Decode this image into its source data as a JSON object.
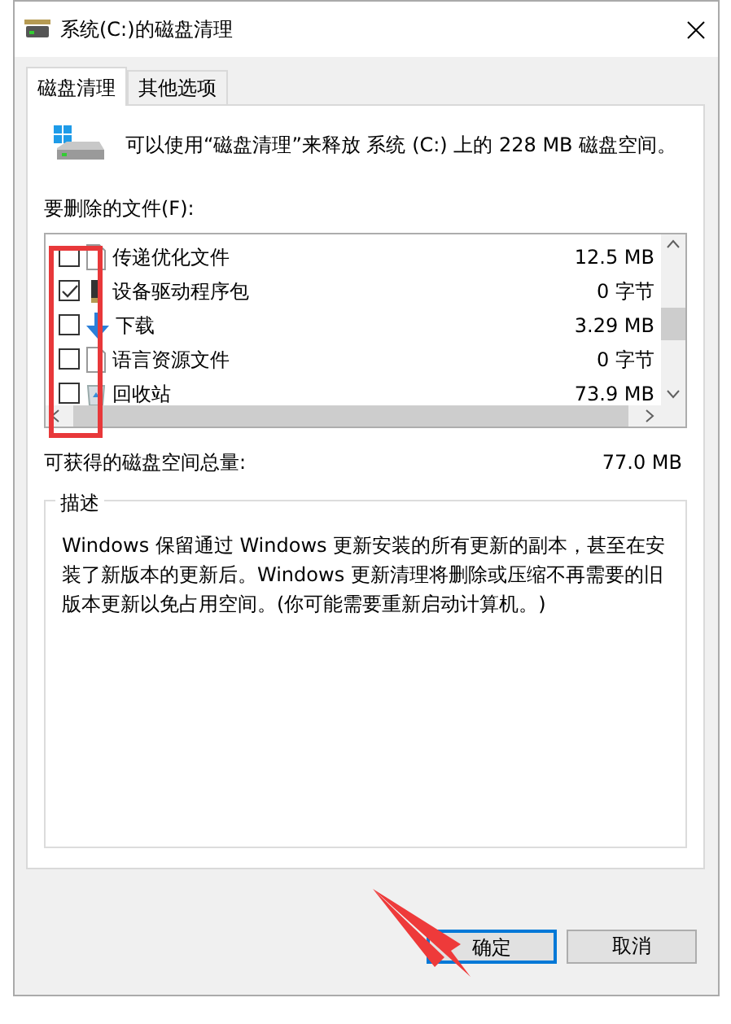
{
  "window": {
    "title": "系统(C:)的磁盘清理"
  },
  "tabs": [
    {
      "label": "磁盘清理",
      "selected": true
    },
    {
      "label": "其他选项",
      "selected": false
    }
  ],
  "intro": "可以使用“磁盘清理”来释放 系统 (C:) 上的 228 MB 磁盘空间。",
  "files_label": "要删除的文件(F):",
  "files": [
    {
      "name": "传递优化文件",
      "size": "12.5 MB",
      "checked": false,
      "kind": "file"
    },
    {
      "name": "设备驱动程序包",
      "size": "0 字节",
      "checked": true,
      "kind": "driver"
    },
    {
      "name": "下载",
      "size": "3.29 MB",
      "checked": false,
      "kind": "download"
    },
    {
      "name": "语言资源文件",
      "size": "0 字节",
      "checked": false,
      "kind": "file"
    },
    {
      "name": "回收站",
      "size": "73.9 MB",
      "checked": false,
      "kind": "trash"
    }
  ],
  "total": {
    "label": "可获得的磁盘空间总量:",
    "value": "77.0 MB"
  },
  "description": {
    "title": "描述",
    "text": "Windows 保留通过 Windows 更新安装的所有更新的副本，甚至在安装了新版本的更新后。Windows 更新清理将删除或压缩不再需要的旧版本更新以免占用空间。(你可能需要重新启动计算机。)"
  },
  "buttons": [
    {
      "label": "确定",
      "default": true
    },
    {
      "label": "取消",
      "default": false
    }
  ]
}
